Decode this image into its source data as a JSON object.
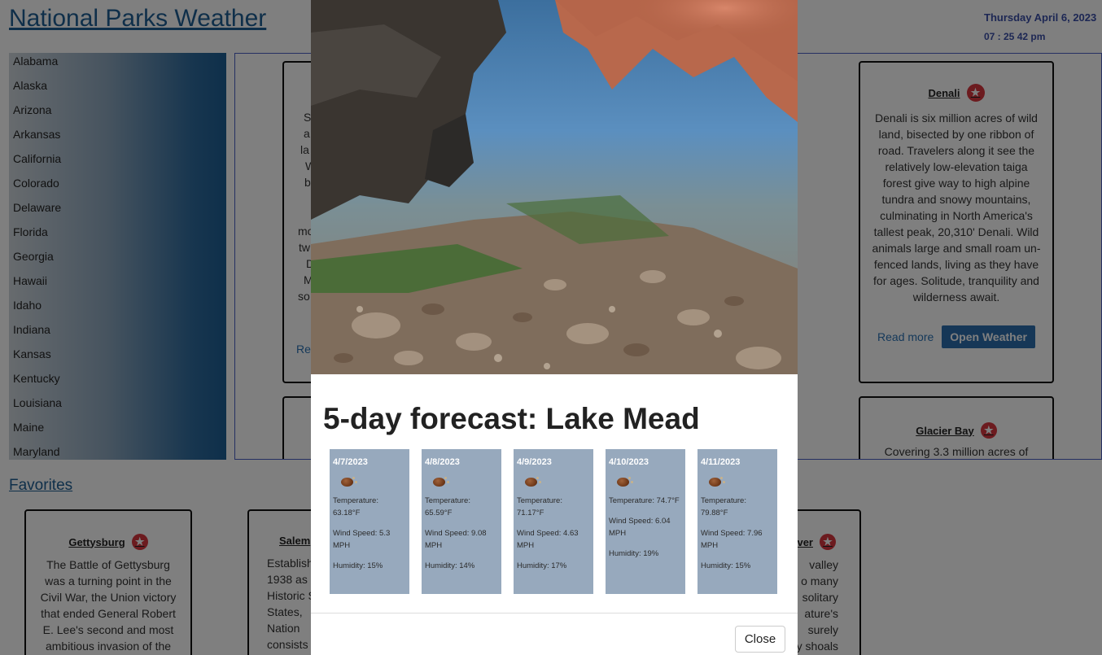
{
  "header": {
    "site_title": "National Parks Weather",
    "date": "Thursday April 6, 2023",
    "time": "07 : 25 42 pm"
  },
  "states": [
    "Alabama",
    "Alaska",
    "Arizona",
    "Arkansas",
    "California",
    "Colorado",
    "Delaware",
    "Florida",
    "Georgia",
    "Hawaii",
    "Idaho",
    "Indiana",
    "Kansas",
    "Kentucky",
    "Louisiana",
    "Maine",
    "Maryland"
  ],
  "park_cards": {
    "denali": {
      "title": "Denali",
      "description": "Denali is six million acres of wild land, bisected by one ribbon of road. Travelers along it see the relatively low-elevation taiga forest give way to high alpine tundra and snowy mountains, culminating in North America's tallest peak, 20,310' Denali. Wild animals large and small roam un-fenced lands, living as they have for ages. Solitude, tranquility and wilderness await.",
      "read_more": "Read more",
      "open_weather": "Open Weather"
    },
    "glacier_bay": {
      "title": "Glacier Bay",
      "description": "Covering 3.3 million acres of"
    },
    "partial_left_fragments": [
      "S",
      "a",
      "la",
      "W",
      "b",
      "mo",
      "tw",
      "D",
      "M",
      "so",
      "Re"
    ]
  },
  "favorites": {
    "title": "Favorites",
    "cards": [
      {
        "title": "Gettysburg",
        "description": "The Battle of Gettysburg was a turning point in the Civil War, the Union victory that ended General Robert E. Lee's second and most ambitious invasion of the"
      },
      {
        "title": "Salem",
        "description_lines": [
          "Establish",
          "1938 as",
          "Historic S",
          "States,",
          "Nation",
          "consists"
        ]
      },
      {
        "title": "ver",
        "description_lines": [
          "valley",
          "o many",
          "solitary",
          "ature's",
          "surely",
          "y shoals"
        ]
      }
    ]
  },
  "modal": {
    "title": "5-day forecast: Lake Mead",
    "forecast": [
      {
        "date": "4/7/2023",
        "temperature": "Temperature: 63.18°F",
        "wind": "Wind Speed: 5.3 MPH",
        "humidity": "Humidity: 15%"
      },
      {
        "date": "4/8/2023",
        "temperature": "Temperature: 65.59°F",
        "wind": "Wind Speed: 9.08 MPH",
        "humidity": "Humidity: 14%"
      },
      {
        "date": "4/9/2023",
        "temperature": "Temperature: 71.17°F",
        "wind": "Wind Speed: 4.63 MPH",
        "humidity": "Humidity: 17%"
      },
      {
        "date": "4/10/2023",
        "temperature": "Temperature: 74.7°F",
        "wind": "Wind Speed: 6.04 MPH",
        "humidity": "Humidity: 19%"
      },
      {
        "date": "4/11/2023",
        "temperature": "Temperature: 79.88°F",
        "wind": "Wind Speed: 7.96 MPH",
        "humidity": "Humidity: 15%"
      }
    ],
    "close_label": "Close"
  },
  "colors": {
    "accent_blue": "#1e5f94",
    "button_blue": "#2c6fae",
    "favorite_star": "#d9363e",
    "forecast_card": "#97a9bd"
  },
  "icons": {
    "favorite": "star-icon",
    "weather": "weather-icon"
  }
}
